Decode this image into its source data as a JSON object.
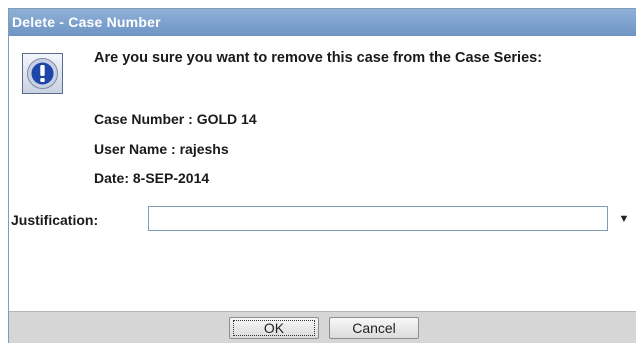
{
  "dialog": {
    "title": "Delete - Case Number",
    "message": "Are you sure you want to remove this case from the Case Series:",
    "case_number_line": "Case Number :  GOLD 14",
    "user_name_line": "User Name : rajeshs",
    "date_line": "Date: 8-SEP-2014",
    "justification_label": "Justification:",
    "justification_value": "",
    "ok_label": "OK",
    "cancel_label": "Cancel"
  },
  "colors": {
    "title_bar": "#7aa0cc",
    "footer": "#d6d6d6",
    "icon_blue": "#1b3f9c"
  },
  "icons": {
    "dialog_icon": "info-exclamation-icon",
    "dropdown": "chevron-down-icon"
  }
}
